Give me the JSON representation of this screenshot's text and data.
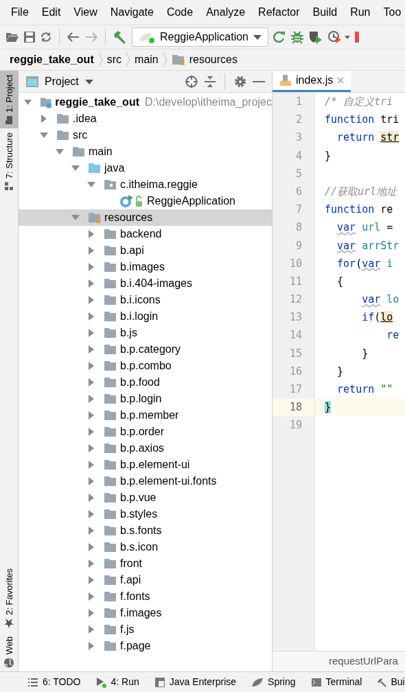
{
  "menu": [
    "File",
    "Edit",
    "View",
    "Navigate",
    "Code",
    "Analyze",
    "Refactor",
    "Build",
    "Run",
    "Too"
  ],
  "toolbar": {
    "navigation": [
      {
        "disabled": false
      },
      {
        "disabled": true
      }
    ],
    "run_config": "ReggieApplication"
  },
  "breadcrumbs": [
    {
      "label": "reggie_take_out",
      "kind": "project"
    },
    {
      "label": "src",
      "kind": "plain"
    },
    {
      "label": "main",
      "kind": "plain"
    },
    {
      "label": "resources",
      "kind": "resources"
    }
  ],
  "side_tabs_top": [
    {
      "label": "1: Project",
      "selected": true
    },
    {
      "label": "7: Structure",
      "selected": false
    }
  ],
  "side_tabs_bottom": [
    {
      "label": "2: Favorites",
      "kind": "star"
    },
    {
      "label": "Web",
      "kind": "globe"
    }
  ],
  "project_panel": {
    "title": "Project",
    "tree": [
      {
        "label": "reggie_take_out",
        "kind": "module",
        "hint": "D:\\develop\\itheima_projec",
        "expanded": true,
        "selected": false,
        "children": [
          {
            "label": ".idea",
            "kind": "folder",
            "expanded": false,
            "selected": false
          },
          {
            "label": "src",
            "kind": "folder",
            "expanded": true,
            "selected": false,
            "children": [
              {
                "label": "main",
                "kind": "folder",
                "expanded": true,
                "selected": false,
                "children": [
                  {
                    "label": "java",
                    "kind": "source",
                    "expanded": true,
                    "selected": false,
                    "children": [
                      {
                        "label": "c.itheima.reggie",
                        "kind": "package",
                        "expanded": true,
                        "selected": false,
                        "children": [
                          {
                            "label": "ReggieApplication",
                            "kind": "class",
                            "selected": false
                          }
                        ]
                      }
                    ]
                  },
                  {
                    "label": "resources",
                    "kind": "resources",
                    "expanded": true,
                    "selected": true,
                    "children": [
                      {
                        "label": "backend",
                        "kind": "folder",
                        "expanded": false,
                        "selected": false
                      },
                      {
                        "label": "b.api",
                        "kind": "folder",
                        "expanded": false,
                        "selected": false
                      },
                      {
                        "label": "b.images",
                        "kind": "folder",
                        "expanded": false,
                        "selected": false
                      },
                      {
                        "label": "b.i.404-images",
                        "kind": "folder",
                        "expanded": false,
                        "selected": false
                      },
                      {
                        "label": "b.i.icons",
                        "kind": "folder",
                        "expanded": false,
                        "selected": false
                      },
                      {
                        "label": "b.i.login",
                        "kind": "folder",
                        "expanded": false,
                        "selected": false
                      },
                      {
                        "label": "b.js",
                        "kind": "folder",
                        "expanded": false,
                        "selected": false
                      },
                      {
                        "label": "b.p.category",
                        "kind": "folder",
                        "expanded": false,
                        "selected": false
                      },
                      {
                        "label": "b.p.combo",
                        "kind": "folder",
                        "expanded": false,
                        "selected": false
                      },
                      {
                        "label": "b.p.food",
                        "kind": "folder",
                        "expanded": false,
                        "selected": false
                      },
                      {
                        "label": "b.p.login",
                        "kind": "folder",
                        "expanded": false,
                        "selected": false
                      },
                      {
                        "label": "b.p.member",
                        "kind": "folder",
                        "expanded": false,
                        "selected": false
                      },
                      {
                        "label": "b.p.order",
                        "kind": "folder",
                        "expanded": false,
                        "selected": false
                      },
                      {
                        "label": "b.p.axios",
                        "kind": "folder",
                        "expanded": false,
                        "selected": false
                      },
                      {
                        "label": "b.p.element-ui",
                        "kind": "folder",
                        "expanded": false,
                        "selected": false
                      },
                      {
                        "label": "b.p.element-ui.fonts",
                        "kind": "folder",
                        "expanded": false,
                        "selected": false
                      },
                      {
                        "label": "b.p.vue",
                        "kind": "folder",
                        "expanded": false,
                        "selected": false
                      },
                      {
                        "label": "b.styles",
                        "kind": "folder",
                        "expanded": false,
                        "selected": false
                      },
                      {
                        "label": "b.s.fonts",
                        "kind": "folder",
                        "expanded": false,
                        "selected": false
                      },
                      {
                        "label": "b.s.icon",
                        "kind": "folder",
                        "expanded": false,
                        "selected": false
                      },
                      {
                        "label": "front",
                        "kind": "folder",
                        "expanded": false,
                        "selected": false
                      },
                      {
                        "label": "f.api",
                        "kind": "folder",
                        "expanded": false,
                        "selected": false
                      },
                      {
                        "label": "f.fonts",
                        "kind": "folder",
                        "expanded": false,
                        "selected": false
                      },
                      {
                        "label": "f.images",
                        "kind": "folder",
                        "expanded": false,
                        "selected": false
                      },
                      {
                        "label": "f.js",
                        "kind": "folder",
                        "expanded": false,
                        "selected": false
                      },
                      {
                        "label": "f.page",
                        "kind": "folder",
                        "expanded": false,
                        "selected": false
                      }
                    ]
                  }
                ]
              }
            ]
          }
        ]
      }
    ]
  },
  "editor": {
    "tabs": [
      {
        "label": "index.js",
        "selected": true
      }
    ],
    "lines": [
      {
        "number": "1",
        "current": false,
        "tokens": [
          {
            "text": "/* 自定义tri",
            "kind": "comment"
          }
        ]
      },
      {
        "number": "2",
        "current": false,
        "tokens": [
          {
            "text": "function",
            "kind": "keyword"
          },
          {
            "text": " tri",
            "kind": "plain"
          }
        ]
      },
      {
        "number": "3",
        "current": false,
        "tokens": [
          {
            "text": "  return",
            "kind": "keyword"
          },
          {
            "text": " str",
            "kind": "match"
          }
        ]
      },
      {
        "number": "4",
        "current": false,
        "tokens": [
          {
            "text": "}",
            "kind": "plain"
          }
        ]
      },
      {
        "number": "5",
        "current": false
      },
      {
        "number": "6",
        "current": false,
        "tokens": [
          {
            "text": "//获取url地址",
            "kind": "comment"
          }
        ]
      },
      {
        "number": "7",
        "current": false,
        "tokens": [
          {
            "text": "function",
            "kind": "keyword"
          },
          {
            "text": " re",
            "kind": "plain"
          }
        ]
      },
      {
        "number": "8",
        "current": false,
        "tokens": [
          {
            "text": "  var",
            "kind": "warn"
          },
          {
            "text": " url",
            "kind": "variable"
          },
          {
            "text": " =",
            "kind": "plain"
          }
        ]
      },
      {
        "number": "9",
        "current": false,
        "tokens": [
          {
            "text": "  var",
            "kind": "warn"
          },
          {
            "text": " arrStr",
            "kind": "variable"
          }
        ]
      },
      {
        "number": "10",
        "current": false,
        "tokens": [
          {
            "text": "  for",
            "kind": "keyword"
          },
          {
            "text": "(",
            "kind": "plain"
          },
          {
            "text": "var",
            "kind": "warn"
          },
          {
            "text": " i",
            "kind": "variable"
          }
        ]
      },
      {
        "number": "11",
        "current": false,
        "tokens": [
          {
            "text": "  {",
            "kind": "plain"
          }
        ]
      },
      {
        "number": "12",
        "current": false,
        "tokens": [
          {
            "text": "      var",
            "kind": "warn"
          },
          {
            "text": " lo",
            "kind": "variable"
          }
        ]
      },
      {
        "number": "13",
        "current": false,
        "tokens": [
          {
            "text": "      if",
            "kind": "keyword"
          },
          {
            "text": "(",
            "kind": "plain"
          },
          {
            "text": "lo",
            "kind": "match"
          }
        ]
      },
      {
        "number": "14",
        "current": false,
        "tokens": [
          {
            "text": "          re",
            "kind": "keyword"
          }
        ]
      },
      {
        "number": "15",
        "current": false,
        "tokens": [
          {
            "text": "      }",
            "kind": "plain"
          }
        ]
      },
      {
        "number": "16",
        "current": false,
        "tokens": [
          {
            "text": "  }",
            "kind": "plain"
          }
        ]
      },
      {
        "number": "17",
        "current": false,
        "tokens": [
          {
            "text": "  return",
            "kind": "keyword"
          },
          {
            "text": " \"\"",
            "kind": "string"
          }
        ]
      },
      {
        "number": "18",
        "current": true,
        "tokens": [
          {
            "text": "}",
            "kind": "brace"
          }
        ]
      },
      {
        "number": "19",
        "current": false
      }
    ],
    "breadcrumb": "requestUrlPara"
  },
  "bottom_tabs": [
    {
      "label": "6: TODO",
      "kind": "todo"
    },
    {
      "label": "4: Run",
      "kind": "run"
    },
    {
      "label": "Java Enterprise",
      "kind": "enterprise"
    },
    {
      "label": "Spring",
      "kind": "spring"
    },
    {
      "label": "Terminal",
      "kind": "terminal"
    },
    {
      "label": "Bui",
      "kind": "build"
    }
  ]
}
